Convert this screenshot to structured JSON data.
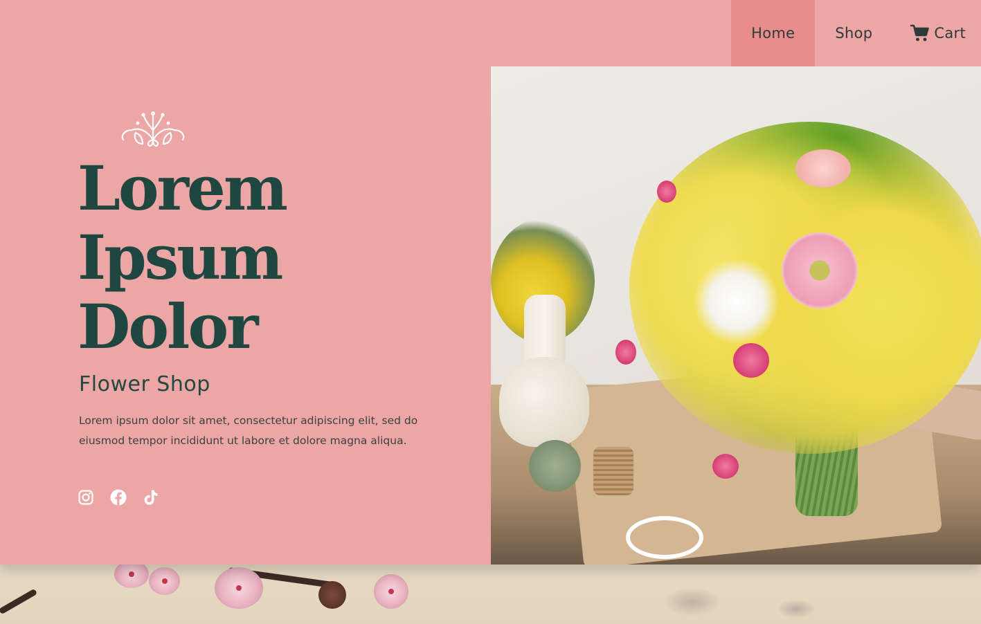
{
  "nav": {
    "items": [
      {
        "label": "Home",
        "active": true
      },
      {
        "label": "Shop",
        "active": false
      }
    ],
    "cart": {
      "label": "Cart",
      "icon": "cart-icon"
    }
  },
  "hero": {
    "ornament_icon": "floral-ornament-icon",
    "headline_lines": [
      "Lorem",
      "Ipsum",
      "Dolor"
    ],
    "subtitle": "Flower Shop",
    "body": "Lorem ipsum dolor sit amet, consectetur adipiscing elit, sed do eiusmod tempor incididunt ut labore et dolore magna aliqua.",
    "socials": [
      {
        "icon": "instagram-icon"
      },
      {
        "icon": "facebook-icon"
      },
      {
        "icon": "tiktok-icon"
      }
    ]
  },
  "colors": {
    "panel": "#eba6a5",
    "nav_active": "#e78d8c",
    "headline": "#1f4740",
    "text": "#3a4341"
  }
}
